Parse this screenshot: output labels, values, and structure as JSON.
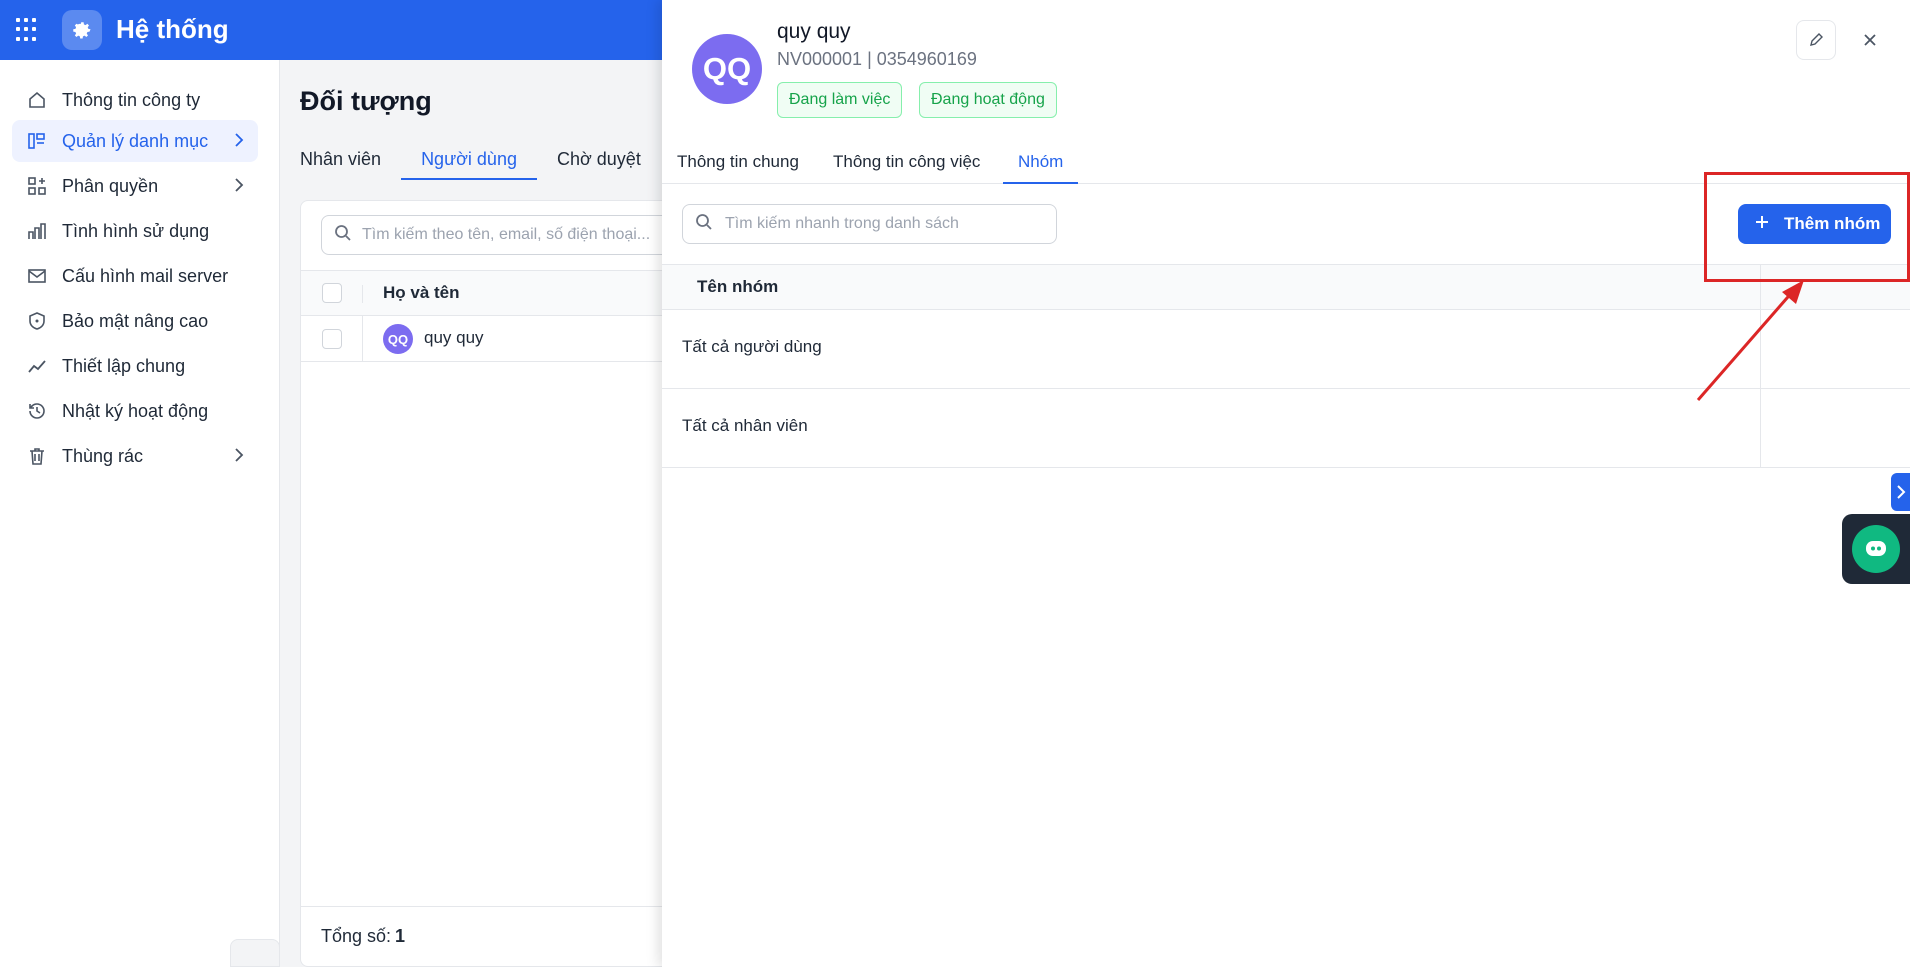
{
  "app": {
    "title": "Hệ thống"
  },
  "sidebar": {
    "items": [
      {
        "label": "Thông tin công ty",
        "icon": "home-icon"
      },
      {
        "label": "Quản lý danh mục",
        "icon": "category-icon",
        "active": true,
        "has_children": true
      },
      {
        "label": "Phân quyền",
        "icon": "permissions-icon",
        "has_children": true
      },
      {
        "label": "Tình hình sử dụng",
        "icon": "bar-chart-icon"
      },
      {
        "label": "Cấu hình mail server",
        "icon": "mail-icon"
      },
      {
        "label": "Bảo mật nâng cao",
        "icon": "shield-icon"
      },
      {
        "label": "Thiết lập chung",
        "icon": "trend-icon"
      },
      {
        "label": "Nhật ký hoạt động",
        "icon": "history-icon"
      },
      {
        "label": "Thùng rác",
        "icon": "trash-icon",
        "has_children": true
      }
    ]
  },
  "main": {
    "title": "Đối tượng",
    "tabs": [
      "Nhân viên",
      "Người dùng",
      "Chờ duyệt"
    ],
    "active_tab": "Người dùng",
    "search_placeholder": "Tìm kiếm theo tên, email, số điện thoại...",
    "table": {
      "header_name": "Họ và tên",
      "rows": [
        {
          "initials": "QQ",
          "name": "quy quy"
        }
      ]
    },
    "footer": {
      "total_label": "Tổng số:",
      "total_value": "1"
    }
  },
  "drawer": {
    "initials": "QQ",
    "name": "quy quy",
    "subtitle": "NV000001 | 0354960169",
    "badges": [
      "Đang làm việc",
      "Đang hoạt động"
    ],
    "tabs": [
      "Thông tin chung",
      "Thông tin công việc",
      "Nhóm"
    ],
    "active_tab": "Nhóm",
    "search_placeholder": "Tìm kiếm nhanh trong danh sách",
    "add_button": "Thêm nhóm",
    "table_header": "Tên nhóm",
    "groups": [
      "Tất cả người dùng",
      "Tất cả nhân viên"
    ]
  },
  "colors": {
    "primary": "#2563eb",
    "annotation": "#dc2626",
    "avatar": "#7c6cf0",
    "badge_green": "#16a34a"
  }
}
